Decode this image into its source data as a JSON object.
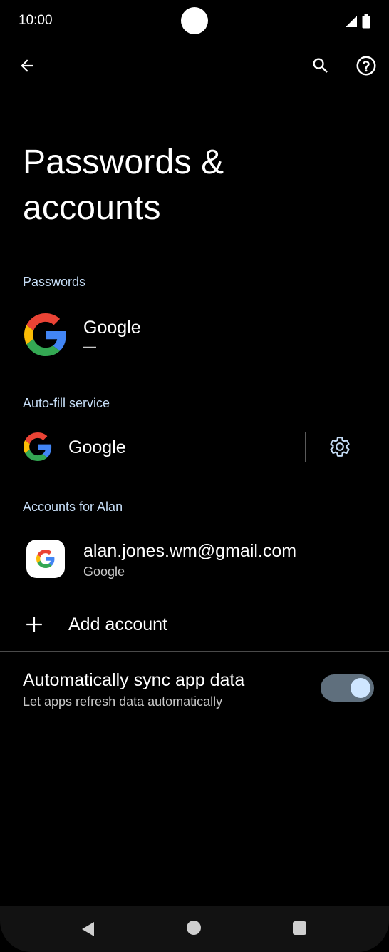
{
  "status_bar": {
    "time": "10:00",
    "icons": [
      "signal-icon",
      "battery-icon"
    ]
  },
  "app_bar": {
    "icons": [
      "back-arrow-icon",
      "search-icon",
      "help-icon"
    ]
  },
  "page": {
    "title": "Passwords & accounts"
  },
  "passwords": {
    "header": "Passwords",
    "item": {
      "title": "Google",
      "subtitle": "—",
      "icon": "google-g-icon"
    }
  },
  "autofill": {
    "header": "Auto-fill service",
    "item": {
      "title": "Google",
      "icon": "google-g-icon",
      "settings_icon": "gear-icon"
    }
  },
  "accounts": {
    "header": "Accounts for Alan",
    "item": {
      "title": "alan.jones.wm@gmail.com",
      "subtitle": "Google",
      "icon": "google-g-icon"
    },
    "add_label": "Add account",
    "add_icon": "plus-icon"
  },
  "sync": {
    "title": "Automatically sync app data",
    "subtitle": "Let apps refresh data automatically",
    "enabled": true
  },
  "colors": {
    "background": "#000000",
    "section_header": "#c5dcf5",
    "accent": "#c5dcf5",
    "toggle_track": "#5f6f7d",
    "toggle_thumb": "#cfe6ff",
    "google_blue": "#4285F4",
    "google_red": "#EA4335",
    "google_yellow": "#FBBC05",
    "google_green": "#34A853"
  },
  "nav_bar": {
    "icons": [
      "nav-back-icon",
      "nav-home-icon",
      "nav-recents-icon"
    ]
  }
}
